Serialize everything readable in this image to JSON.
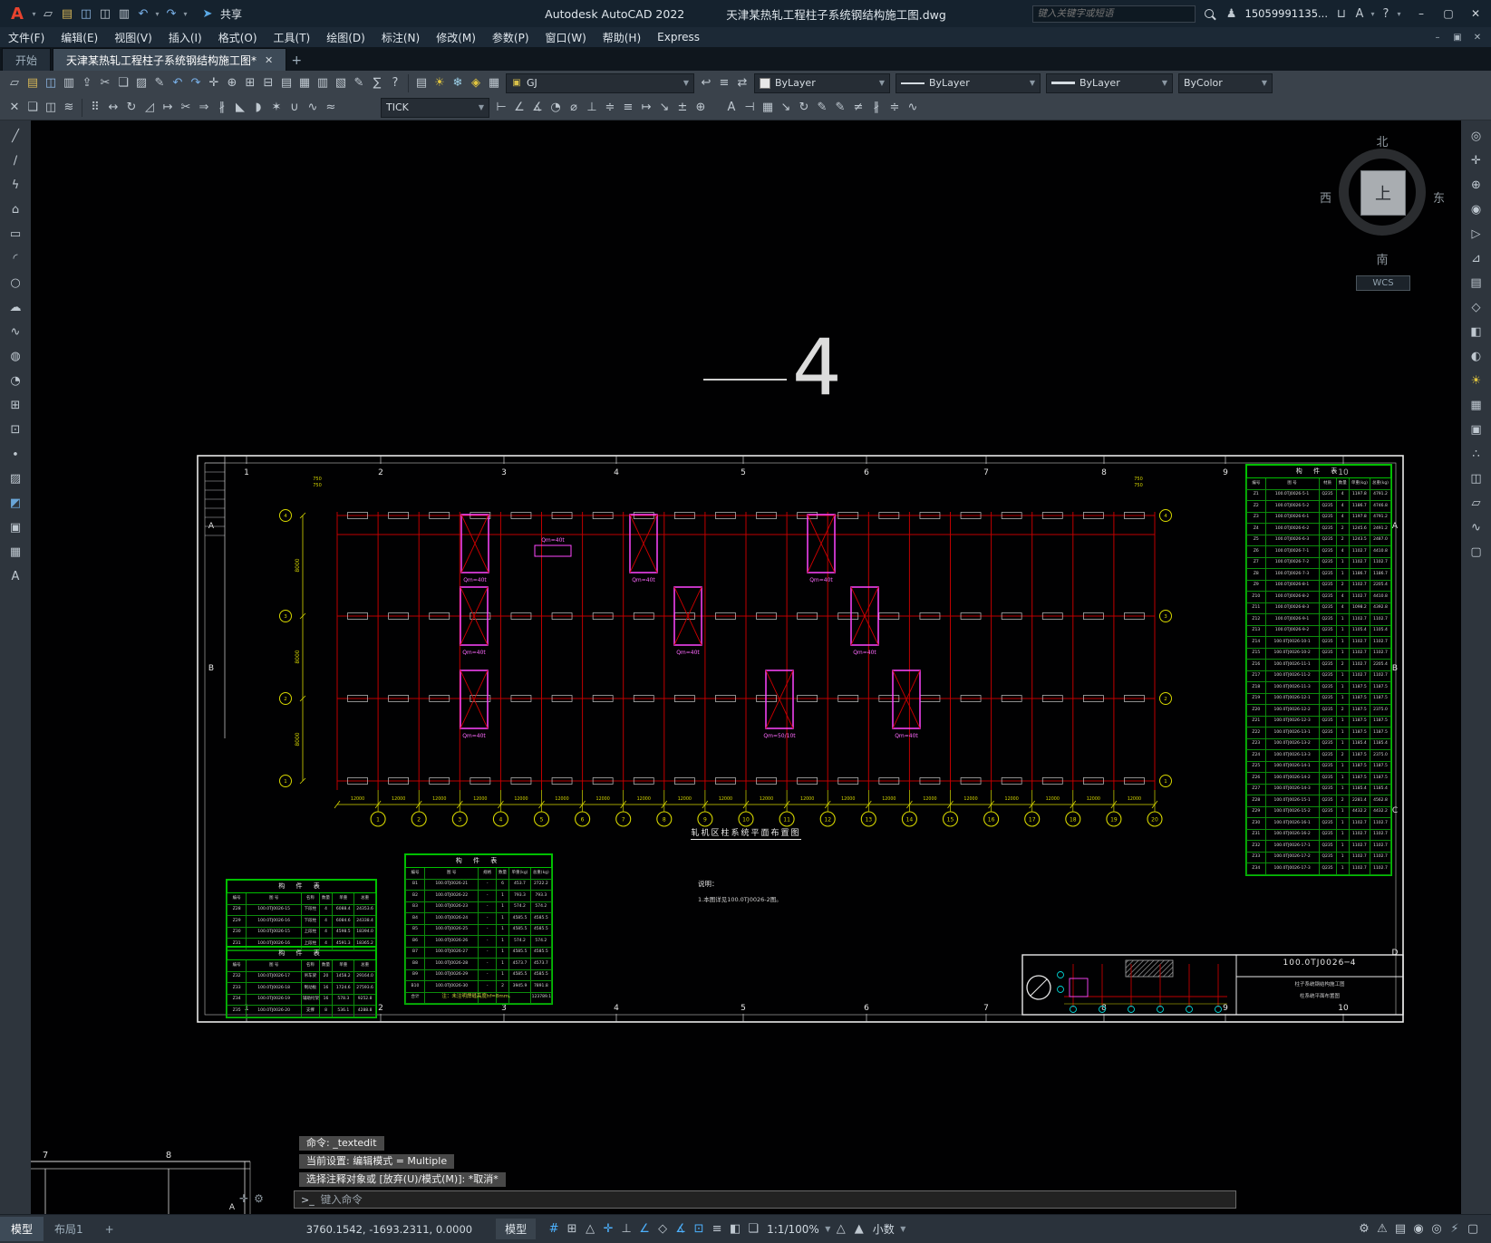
{
  "titlebar": {
    "app_title": "Autodesk AutoCAD 2022",
    "doc_title": "天津某热轧工程柱子系统钢结构施工图.dwg",
    "share_label": "共享",
    "search_placeholder": "键入关键字或短语",
    "account": "15059991135...",
    "quick_access": [
      "app-logo",
      "caret",
      "new",
      "open",
      "save",
      "save-as",
      "plot",
      "undo",
      "caret",
      "redo",
      "caret"
    ],
    "right_icons_a": [
      "search"
    ],
    "right_icons_b": [
      "user"
    ],
    "right_icons_c": [
      "cart",
      "autodesk",
      "caret",
      "help",
      "caret"
    ],
    "window_buttons": [
      "minimize",
      "maximize",
      "close"
    ]
  },
  "menubar": {
    "items": [
      "文件(F)",
      "编辑(E)",
      "视图(V)",
      "插入(I)",
      "格式(O)",
      "工具(T)",
      "绘图(D)",
      "标注(N)",
      "修改(M)",
      "参数(P)",
      "窗口(W)",
      "帮助(H)",
      "Express"
    ],
    "doc_window_buttons": [
      "minimize",
      "restore",
      "close"
    ]
  },
  "tabs": {
    "start": "开始",
    "document": "天津某热轧工程柱子系统钢结构施工图*",
    "new_tab": "+"
  },
  "toolbar1": {
    "cluster1": [
      "qnew",
      "open",
      "save",
      "plot",
      "publish",
      "cut",
      "copy-clip",
      "paste",
      "match-properties",
      "undo",
      "redo",
      "pan",
      "zoom-realtime",
      "zoom-window",
      "zoom-previous",
      "properties",
      "design-center",
      "tool-palettes",
      "sheet-set-manager",
      "markup-import",
      "quick-calc",
      "help"
    ],
    "layer_cluster": [
      "layer-properties",
      "layer-on",
      "layer-freeze",
      "layer-lock",
      "layer-color"
    ],
    "layer_value": "GJ",
    "post_layer_cluster": [
      "layer-previous",
      "layer-states",
      "layer-translate"
    ],
    "color_value": "ByLayer",
    "linetype_value": "ByLayer",
    "lineweight_value": "ByLayer",
    "plotstyle_value": "ByColor"
  },
  "toolbar2": {
    "cluster1": [
      "erase",
      "copy",
      "mirror",
      "offset"
    ],
    "cluster2": [
      "array",
      "move",
      "rotate",
      "scale",
      "stretch",
      "trim",
      "extend",
      "break",
      "chamfer",
      "fillet",
      "explode",
      "join",
      "polyline-edit",
      "spline-edit"
    ],
    "dimstyle_value": "TICK",
    "cluster3": [
      "dim-linear",
      "dim-aligned",
      "dim-angular",
      "dim-radius",
      "dim-diameter",
      "dim-ordinate",
      "qdim",
      "dim-baseline",
      "dim-continue",
      "leader",
      "tolerance",
      "center-mark"
    ],
    "cluster4": [
      "text-style",
      "dim-style",
      "table-style",
      "mleader-style",
      "dim-update",
      "dim-edit",
      "dim-text-edit",
      "override",
      "dim-break",
      "dim-space",
      "dim-jog"
    ]
  },
  "left_palette": [
    "line",
    "construction-line",
    "polyline",
    "polygon",
    "rectangle",
    "arc",
    "circle",
    "revision-cloud",
    "spline",
    "ellipse",
    "ellipse-arc",
    "insert-block",
    "create-block",
    "point",
    "hatch",
    "gradient",
    "region",
    "table",
    "multiline-text"
  ],
  "right_palette": [
    "steering-wheel",
    "pan",
    "zoom",
    "orbit",
    "show-motion",
    "ucs",
    "named-views",
    "3d-views",
    "visual-styles",
    "render",
    "lights",
    "materials",
    "camera",
    "walk",
    "section",
    "flat-shot",
    "motion-path",
    "viewport"
  ],
  "canvas": {
    "big_label": "4",
    "viewcube": {
      "north": "北",
      "south": "南",
      "east": "东",
      "west": "西",
      "top": "上",
      "wcs": "WCS"
    },
    "plan": {
      "grid_numbers": [
        "1",
        "2",
        "3",
        "4",
        "5",
        "6",
        "7",
        "8",
        "9",
        "10"
      ],
      "letters_left": [
        "A",
        "B"
      ],
      "letters_right": [
        "A",
        "B",
        "C",
        "D"
      ],
      "left_axis_bubbles": [
        "4",
        "3",
        "2",
        "1"
      ],
      "right_axis_bubbles": [
        "4",
        "3",
        "2",
        "1"
      ],
      "bubble_labels": [
        "1",
        "2",
        "3",
        "4",
        "5",
        "6",
        "7",
        "8",
        "9",
        "10",
        "11",
        "12",
        "13",
        "14",
        "15",
        "16",
        "17",
        "18",
        "19",
        "20"
      ],
      "bay_dim": "12000",
      "left_dims": [
        "8000",
        "8000",
        "8000"
      ],
      "corner_dim": "750",
      "column_labels": [
        "Qm=40t",
        "Qm=40t",
        "Qm=40t",
        "Qm=40t",
        "Qm=40t",
        "Qm=40t",
        "Qm=40t",
        "Qm=50/10t",
        "Qm=40t"
      ],
      "standalone_label": "Qm=40t",
      "title": "轧机区柱系统平面布置图",
      "note_title": "说明：",
      "notes": [
        "1.本图详见100.0TJ0026-2图。"
      ]
    },
    "corner_sheet": {
      "labels": [
        "7",
        "8"
      ],
      "letter": "A"
    },
    "title_block": {
      "drawing_no": "100.0TJ0026─4",
      "line1": "柱子系统钢结构施工图",
      "line2": "柱系统平面布置图"
    },
    "right_table": {
      "title": "构 件 表",
      "headers": [
        "编号",
        "图  号",
        "材质",
        "数量",
        "单重(kg)",
        "总重(kg)"
      ],
      "rows": [
        [
          "Z1",
          "100.0TJ0026-5-1",
          "Q235",
          "4",
          "1197.8",
          "4791.2"
        ],
        [
          "Z2",
          "100.0TJ0026-5-2",
          "Q235",
          "4",
          "1186.7",
          "4746.8"
        ],
        [
          "Z3",
          "100.0TJ0026-6-1",
          "Q235",
          "4",
          "1197.8",
          "4791.2"
        ],
        [
          "Z4",
          "100.0TJ0026-6-2",
          "Q235",
          "2",
          "1245.6",
          "2491.2"
        ],
        [
          "Z5",
          "100.0TJ0026-6-3",
          "Q235",
          "2",
          "1243.5",
          "2487.0"
        ],
        [
          "Z6",
          "100.0TJ0026-7-1",
          "Q235",
          "4",
          "1102.7",
          "4410.8"
        ],
        [
          "Z7",
          "100.0TJ0026-7-2",
          "Q235",
          "1",
          "1102.7",
          "1102.7"
        ],
        [
          "Z8",
          "100.0TJ0026-7-3",
          "Q235",
          "1",
          "1186.7",
          "1186.7"
        ],
        [
          "Z9",
          "100.0TJ0026-8-1",
          "Q235",
          "2",
          "1102.7",
          "2205.4"
        ],
        [
          "Z10",
          "100.0TJ0026-8-2",
          "Q235",
          "4",
          "1102.7",
          "4410.8"
        ],
        [
          "Z11",
          "100.0TJ0026-8-3",
          "Q235",
          "4",
          "1098.2",
          "4392.8"
        ],
        [
          "Z12",
          "100.0TJ0026-9-1",
          "Q235",
          "1",
          "1102.7",
          "1102.7"
        ],
        [
          "Z13",
          "100.0TJ0026-9-2",
          "Q235",
          "1",
          "1105.4",
          "1105.4"
        ],
        [
          "Z14",
          "100.0TJ0026-10-1",
          "Q235",
          "1",
          "1102.7",
          "1102.7"
        ],
        [
          "Z15",
          "100.0TJ0026-10-2",
          "Q235",
          "1",
          "1102.7",
          "1102.7"
        ],
        [
          "Z16",
          "100.0TJ0026-11-1",
          "Q235",
          "2",
          "1102.7",
          "2205.4"
        ],
        [
          "Z17",
          "100.0TJ0026-11-2",
          "Q235",
          "1",
          "1102.7",
          "1102.7"
        ],
        [
          "Z18",
          "100.0TJ0026-11-3",
          "Q235",
          "1",
          "1187.5",
          "1187.5"
        ],
        [
          "Z19",
          "100.0TJ0026-12-1",
          "Q235",
          "1",
          "1187.5",
          "1187.5"
        ],
        [
          "Z20",
          "100.0TJ0026-12-2",
          "Q235",
          "2",
          "1187.5",
          "2375.0"
        ],
        [
          "Z21",
          "100.0TJ0026-12-3",
          "Q235",
          "1",
          "1187.5",
          "1187.5"
        ],
        [
          "Z22",
          "100.0TJ0026-13-1",
          "Q235",
          "1",
          "1187.5",
          "1187.5"
        ],
        [
          "Z23",
          "100.0TJ0026-13-2",
          "Q235",
          "1",
          "1185.4",
          "1185.4"
        ],
        [
          "Z24",
          "100.0TJ0026-13-3",
          "Q235",
          "2",
          "1187.5",
          "2375.0"
        ],
        [
          "Z25",
          "100.0TJ0026-14-1",
          "Q235",
          "1",
          "1187.5",
          "1187.5"
        ],
        [
          "Z26",
          "100.0TJ0026-14-2",
          "Q235",
          "1",
          "1187.5",
          "1187.5"
        ],
        [
          "Z27",
          "100.0TJ0026-14-3",
          "Q235",
          "1",
          "1185.4",
          "1185.4"
        ],
        [
          "Z28",
          "100.0TJ0026-15-1",
          "Q235",
          "2",
          "2281.4",
          "4562.8"
        ],
        [
          "Z29",
          "100.0TJ0026-15-2",
          "Q235",
          "1",
          "4432.2",
          "4432.2"
        ],
        [
          "Z30",
          "100.0TJ0026-16-1",
          "Q235",
          "1",
          "1102.7",
          "1102.7"
        ],
        [
          "Z31",
          "100.0TJ0026-16-2",
          "Q235",
          "1",
          "1102.7",
          "1102.7"
        ],
        [
          "Z32",
          "100.0TJ0026-17-1",
          "Q235",
          "1",
          "1102.7",
          "1102.7"
        ],
        [
          "Z33",
          "100.0TJ0026-17-2",
          "Q235",
          "1",
          "1102.7",
          "1102.7"
        ],
        [
          "Z34",
          "100.0TJ0026-17-3",
          "Q235",
          "1",
          "1102.7",
          "1102.7"
        ]
      ]
    },
    "mid_table": {
      "title": "构 件 表",
      "headers": [
        "编号",
        "图  号",
        "规格",
        "数量",
        "单重(kg)",
        "总重(kg)"
      ],
      "rows": [
        [
          "B1",
          "100.0TJ0026-21",
          "-",
          "6",
          "453.7",
          "2722.2"
        ],
        [
          "B2",
          "100.0TJ0026-22",
          "-",
          "1",
          "793.3",
          "793.3"
        ],
        [
          "B3",
          "100.0TJ0026-23",
          "-",
          "1",
          "574.2",
          "574.2"
        ],
        [
          "B4",
          "100.0TJ0026-24",
          "-",
          "1",
          "4585.5",
          "4585.5"
        ],
        [
          "B5",
          "100.0TJ0026-25",
          "-",
          "1",
          "4585.5",
          "4585.5"
        ],
        [
          "B6",
          "100.0TJ0026-26",
          "-",
          "1",
          "574.2",
          "574.2"
        ],
        [
          "B7",
          "100.0TJ0026-27",
          "-",
          "1",
          "4585.5",
          "4585.5"
        ],
        [
          "B8",
          "100.0TJ0026-28",
          "-",
          "1",
          "4573.7",
          "4573.7"
        ],
        [
          "B9",
          "100.0TJ0026-29",
          "-",
          "1",
          "4585.5",
          "4585.5"
        ],
        [
          "B10",
          "100.0TJ0026-30",
          "-",
          "2",
          "3945.9",
          "7891.8"
        ],
        [
          "合计",
          "",
          "",
          "",
          "",
          "123789.1"
        ]
      ],
      "caption": "注：未注明焊缝高度hf=8mm。"
    },
    "left_table_top": {
      "title": "构 件 表",
      "headers": [
        "编号",
        "图 号",
        "名称",
        "数量",
        "单重",
        "总重"
      ],
      "rows": [
        [
          "Z28",
          "100.0TJ0026-15",
          "下段柱",
          "4",
          "6088.4",
          "24353.6"
        ],
        [
          "Z29",
          "100.0TJ0026-16",
          "下段柱",
          "4",
          "6084.6",
          "24338.4"
        ],
        [
          "Z30",
          "100.0TJ0026-15",
          "上段柱",
          "4",
          "4598.5",
          "18394.0"
        ],
        [
          "Z31",
          "100.0TJ0026-16",
          "上段柱",
          "4",
          "4591.3",
          "18365.2"
        ]
      ]
    },
    "left_table_bottom": {
      "title": "构 件 表",
      "headers": [
        "编号",
        "图 号",
        "名称",
        "数量",
        "单重",
        "总重"
      ],
      "rows": [
        [
          "Z32",
          "100.0TJ0026-17",
          "吊车梁",
          "20",
          "1458.2",
          "29164.0"
        ],
        [
          "Z33",
          "100.0TJ0026-18",
          "制动板",
          "16",
          "1724.6",
          "27593.6"
        ],
        [
          "Z34",
          "100.0TJ0026-19",
          "辅助桁架",
          "16",
          "578.3",
          "9252.8"
        ],
        [
          "Z35",
          "100.0TJ0026-20",
          "支撑",
          "8",
          "536.1",
          "4288.8"
        ]
      ]
    }
  },
  "command": {
    "line1": "命令: _textedit",
    "line2": "当前设置: 编辑模式 = Multiple",
    "line3": "选择注释对象或 [放弃(U)/模式(M)]: *取消*",
    "placeholder": "键入命令",
    "handle_icons": [
      "move-handle",
      "customize"
    ]
  },
  "statusbar": {
    "model_tab": "模型",
    "layout_tab": "布局1",
    "new_layout": "+",
    "coords": "3760.1542, -1693.2311, 0.0000",
    "model_space": "模型",
    "toggles": [
      {
        "name": "grid",
        "active": true
      },
      {
        "name": "snap-mode",
        "active": false
      },
      {
        "name": "infer-constraints",
        "active": false
      },
      {
        "name": "dynamic-input",
        "active": true
      },
      {
        "name": "ortho",
        "active": false
      },
      {
        "name": "polar-tracking",
        "active": true
      },
      {
        "name": "isometric-drafting",
        "active": false
      },
      {
        "name": "object-snap-tracking",
        "active": true
      },
      {
        "name": "object-snap",
        "active": true
      },
      {
        "name": "lineweight",
        "active": false
      },
      {
        "name": "transparency",
        "active": false
      },
      {
        "name": "selection-cycling",
        "active": false
      }
    ],
    "scale": "1:1/100%",
    "annotation_icons": [
      "annotation-visibility",
      "auto-scale"
    ],
    "units": "小数",
    "right_icons": [
      {
        "name": "workspace",
        "active": false
      },
      {
        "name": "annotation-monitor",
        "active": false
      },
      {
        "name": "quick-properties",
        "active": false
      },
      {
        "name": "lock-ui",
        "active": false
      },
      {
        "name": "isolate-objects",
        "active": false
      },
      {
        "name": "graphics-performance",
        "active": true
      },
      {
        "name": "clean-screen",
        "active": false
      }
    ]
  }
}
